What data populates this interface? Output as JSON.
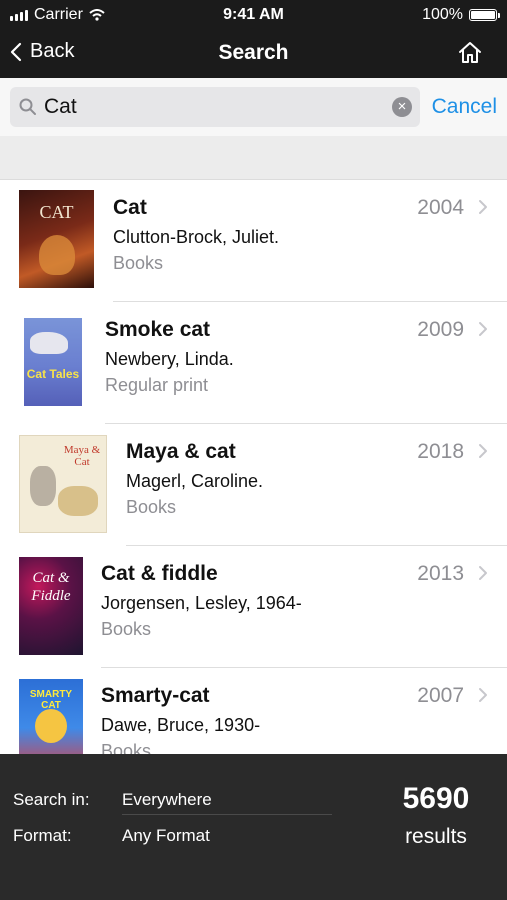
{
  "status_bar": {
    "carrier": "Carrier",
    "time": "9:41 AM",
    "battery": "100%"
  },
  "nav": {
    "back_label": "Back",
    "title": "Search",
    "home_icon": "home-icon"
  },
  "search": {
    "value": "Cat",
    "cancel_label": "Cancel"
  },
  "results": [
    {
      "title": "Cat",
      "author": "Clutton-Brock, Juliet.",
      "format": "Books",
      "year": "2004",
      "cover_text": "CAT"
    },
    {
      "title": "Smoke cat",
      "author": "Newbery, Linda.",
      "format": "Regular print",
      "year": "2009",
      "cover_text": "Cat Tales"
    },
    {
      "title": "Maya & cat",
      "author": "Magerl, Caroline.",
      "format": "Books",
      "year": "2018",
      "cover_text": "Maya & Cat"
    },
    {
      "title": "Cat & fiddle",
      "author": "Jorgensen, Lesley, 1964-",
      "format": "Books",
      "year": "2013",
      "cover_text": "Cat & Fiddle"
    },
    {
      "title": "Smarty-cat",
      "author": "Dawe, Bruce, 1930-",
      "format": "Books",
      "year": "2007",
      "cover_text": "SMARTY CAT"
    }
  ],
  "footer": {
    "search_in_label": "Search in:",
    "search_in_value": "Everywhere",
    "format_label": "Format:",
    "format_value": "Any Format",
    "count": "5690",
    "results_label": "results"
  },
  "colors": {
    "bar": "#1b1b1b",
    "footer": "#2a2a2a",
    "accent": "#1e90e6",
    "secondary_text": "#8e8e93"
  }
}
